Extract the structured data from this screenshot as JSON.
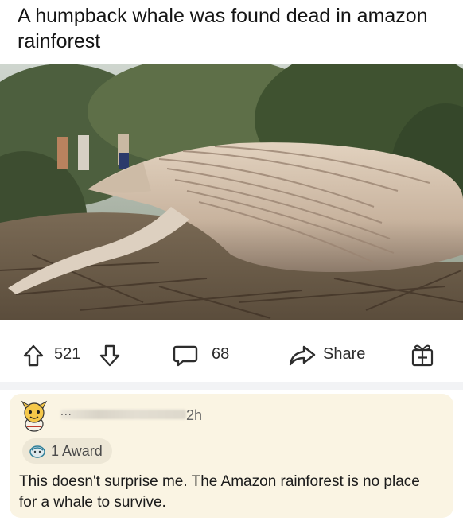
{
  "post": {
    "title": "A humpback whale was found dead in amazon rainforest",
    "image_alt": "Humpback whale carcass lying among trees and branches"
  },
  "actions": {
    "upvotes": "521",
    "comments": "68",
    "share_label": "Share"
  },
  "comment": {
    "username_redacted": "...",
    "time": "2h",
    "award_label": "1 Award",
    "body": "This doesn't surprise me. The Amazon rainforest is no place for a whale to survive."
  },
  "colors": {
    "comment_bg": "#faf4e3",
    "award_pill_bg": "#ede7d6",
    "icon_color": "#2d2d2d"
  },
  "icons": [
    "upvote-icon",
    "downvote-icon",
    "comment-icon",
    "share-icon",
    "award-gift-icon"
  ]
}
